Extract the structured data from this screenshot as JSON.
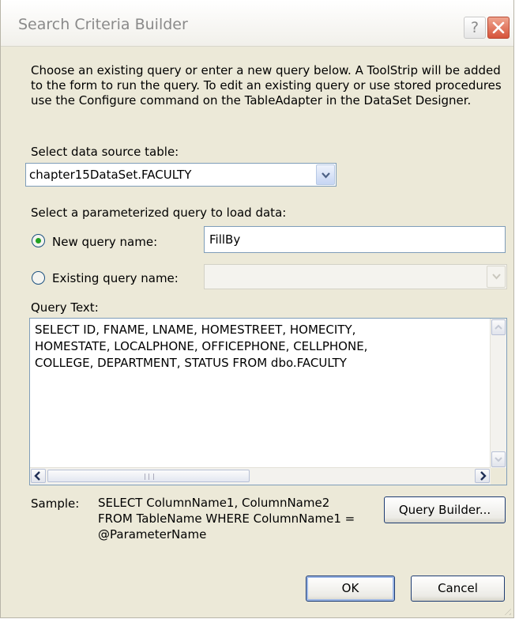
{
  "window": {
    "title": "Search Criteria Builder",
    "help_glyph": "?",
    "close_glyph": "✕"
  },
  "instructions": "Choose an existing query or enter a new query below. A ToolStrip will be added to the form to run the query. To edit an existing query or use stored procedures use the Configure command on the TableAdapter in the DataSet Designer.",
  "data_source": {
    "label": "Select data source table:",
    "value": "chapter15DataSet.FACULTY"
  },
  "parameterized_query": {
    "label": "Select a parameterized query to load data:",
    "new_query": {
      "label": "New query name:",
      "value": "FillBy",
      "selected": true
    },
    "existing_query": {
      "label": "Existing query name:",
      "value": "",
      "selected": false
    }
  },
  "query_text": {
    "label": "Query Text:",
    "value": "SELECT ID, FNAME, LNAME, HOMESTREET, HOMECITY,\nHOMESTATE, LOCALPHONE, OFFICEPHONE, CELLPHONE,\nCOLLEGE, DEPARTMENT, STATUS FROM dbo.FACULTY"
  },
  "sample": {
    "label": "Sample:",
    "text": "SELECT ColumnName1, ColumnName2\nFROM TableName WHERE ColumnName1 =\n@ParameterName"
  },
  "buttons": {
    "query_builder": "Query Builder...",
    "ok": "OK",
    "cancel": "Cancel"
  },
  "colors": {
    "dialog_bg": "#ece9d8",
    "input_border": "#7f9db9",
    "radio_dot": "#21a121",
    "close_red": "#d6533a"
  }
}
